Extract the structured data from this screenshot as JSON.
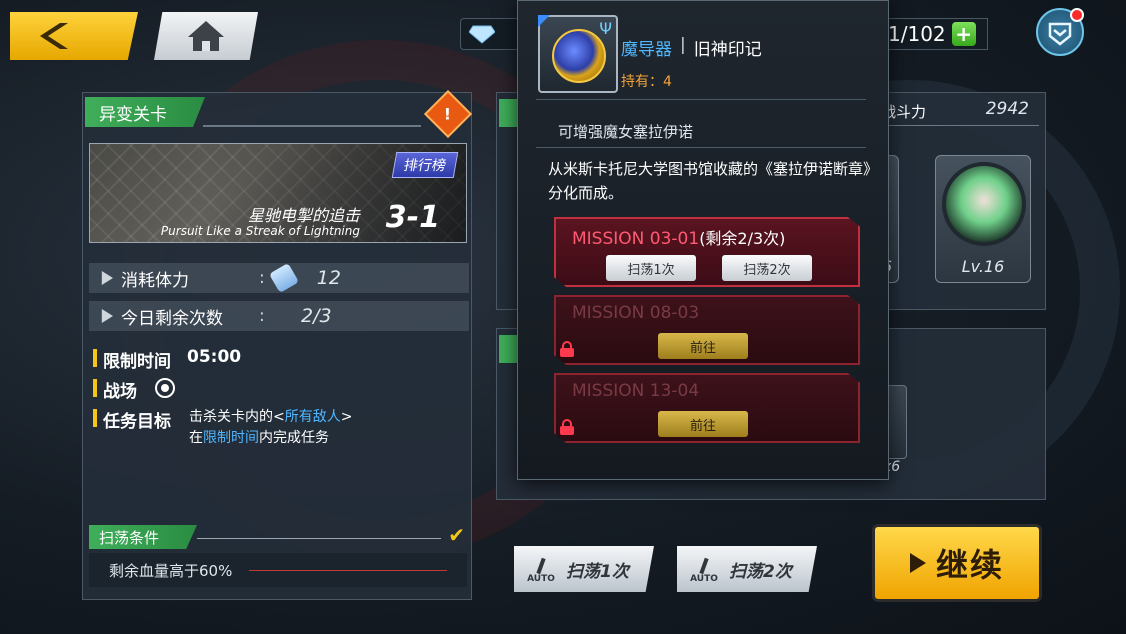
{
  "nav": {
    "stamina_count": "1/102"
  },
  "stage": {
    "panel_title": "异变关卡",
    "difficulty_badge": "!",
    "rank_button": "排行榜",
    "name_cn": "星驰电掣的追击",
    "name_en": "Pursuit Like a Streak of Lightning",
    "number": "3-1",
    "stamina_label": "消耗体力",
    "stamina_sep": ":",
    "stamina_value": "12",
    "attempts_label": "今日剩余次数",
    "attempts_sep": ":",
    "attempts_value": "2/3",
    "time_limit_label": "限制时间",
    "time_limit_value": "05:00",
    "battlefield_label": "战场",
    "objective_label": "任务目标",
    "objective_line1_prefix": "击杀关卡内的<",
    "objective_line1_highlight": "所有敌人",
    "objective_line1_suffix": ">",
    "objective_line2_prefix": "在",
    "objective_line2_highlight": "限制时间",
    "objective_line2_suffix": "内完成任务",
    "sweep_condition_label": "扫荡条件",
    "sweep_condition_text": "剩余血量高于60%"
  },
  "team": {
    "power_label": "战斗力",
    "power_value": "2942",
    "cards": [
      {
        "level": "6"
      },
      {
        "level": "Lv.16"
      }
    ]
  },
  "rewards": {
    "qty": "x6"
  },
  "actions": {
    "auto_label": "AUTO",
    "sweep1": "扫荡1次",
    "sweep2": "扫荡2次",
    "continue": "继续"
  },
  "popup": {
    "item_category": "魔导器",
    "item_sep": "|",
    "item_name": "旧神印记",
    "hold_label": "持有：",
    "hold_count": "4",
    "subtitle": "可增强魔女塞拉伊诺",
    "description": "从米斯卡托尼大学图书馆收藏的《塞拉伊诺断章》分化而成。",
    "missions": [
      {
        "title": "MISSION 03-01",
        "remaining": "(剩余2/3次)",
        "btn1": "扫荡1次",
        "btn2": "扫荡2次",
        "locked": false
      },
      {
        "title": "MISSION 08-03",
        "go": "前往",
        "locked": true
      },
      {
        "title": "MISSION 13-04",
        "go": "前往",
        "locked": true
      }
    ]
  }
}
